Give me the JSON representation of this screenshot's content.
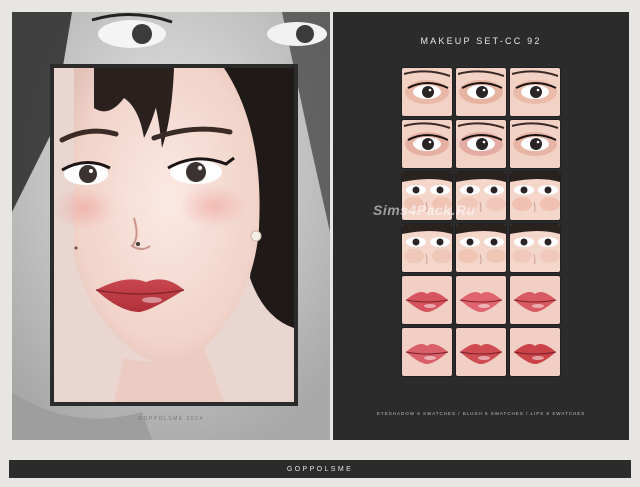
{
  "left": {
    "credit": "GOPPOLSME 2024"
  },
  "right": {
    "title": "MAKEUP SET-CC 92",
    "watermark": "Sims4Pack.Ru",
    "caption": "EYESHADOW 6 SWATCHES / BLUSH 6 SWATCHES / LIPS 6 SWATCHES",
    "rows": [
      {
        "kind": "eyeshadow",
        "tints": [
          "#e9b9a8",
          "#e7b3a1",
          "#ebbba9"
        ]
      },
      {
        "kind": "eyeshadow",
        "tints": [
          "#e5b0a2",
          "#e3aca4",
          "#e6b5a6"
        ]
      },
      {
        "kind": "blush",
        "tints": [
          "#eec2b3",
          "#f0c5b6",
          "#efbfb0"
        ]
      },
      {
        "kind": "blush",
        "tints": [
          "#f0c7b8",
          "#efc3b4",
          "#f1c9bb"
        ]
      },
      {
        "kind": "lips",
        "tints": [
          "#d7545f",
          "#e06370",
          "#d85a62"
        ]
      },
      {
        "kind": "lips",
        "tints": [
          "#d9606a",
          "#cf4d52",
          "#c94348"
        ]
      }
    ]
  },
  "footer": {
    "brand": "GOPPOLSME"
  }
}
